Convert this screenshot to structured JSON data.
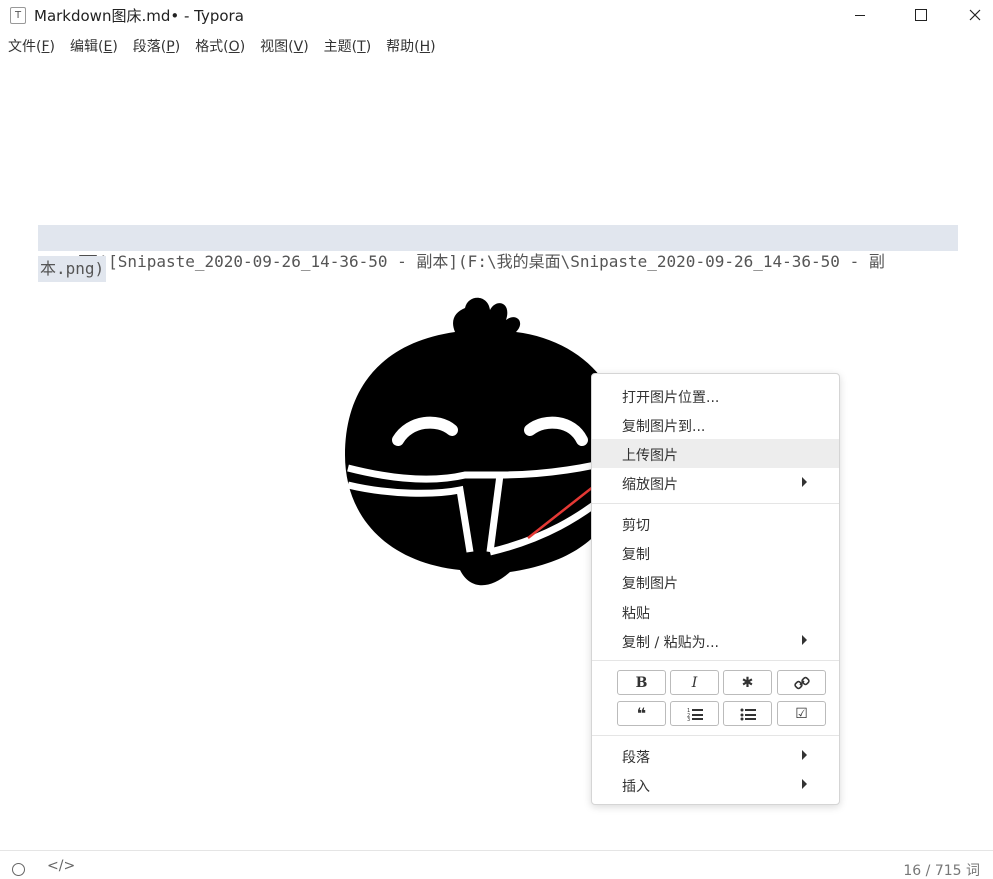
{
  "window": {
    "title": "Markdown图床.md• - Typora",
    "app_icon_letter": "T"
  },
  "menubar": {
    "items": [
      {
        "label": "文件(",
        "key": "F",
        "end": ")"
      },
      {
        "label": "编辑(",
        "key": "E",
        "end": ")"
      },
      {
        "label": "段落(",
        "key": "P",
        "end": ")"
      },
      {
        "label": "格式(",
        "key": "O",
        "end": ")"
      },
      {
        "label": "视图(",
        "key": "V",
        "end": ")"
      },
      {
        "label": "主题(",
        "key": "T",
        "end": ")"
      },
      {
        "label": "帮助(",
        "key": "H",
        "end": ")"
      }
    ]
  },
  "editor": {
    "markdown_line1": "![Snipaste_2020-09-26_14-36-50 - 副本](F:\\我的桌面\\Snipaste_2020-09-26_14-36-50 - 副",
    "markdown_line2": "本.png)"
  },
  "context_menu": {
    "items": [
      {
        "label": "打开图片位置...",
        "submenu": false
      },
      {
        "label": "复制图片到...",
        "submenu": false
      },
      {
        "label": "上传图片",
        "submenu": false,
        "highlighted": true
      },
      {
        "label": "缩放图片",
        "submenu": true
      },
      {
        "label": "剪切",
        "submenu": false
      },
      {
        "label": "复制",
        "submenu": false
      },
      {
        "label": "复制图片",
        "submenu": false
      },
      {
        "label": "粘贴",
        "submenu": false
      },
      {
        "label": "复制 / 粘贴为...",
        "submenu": true
      },
      {
        "label": "段落",
        "submenu": true
      },
      {
        "label": "插入",
        "submenu": true
      }
    ],
    "format_buttons": [
      {
        "icon": "bold-icon",
        "glyph": "B"
      },
      {
        "icon": "italic-icon",
        "glyph": "I"
      },
      {
        "icon": "code-icon",
        "glyph": "✱"
      },
      {
        "icon": "link-icon",
        "glyph": "🔗"
      },
      {
        "icon": "quote-icon",
        "glyph": "❝"
      },
      {
        "icon": "ordered-list-icon",
        "glyph": "☰"
      },
      {
        "icon": "unordered-list-icon",
        "glyph": "☰"
      },
      {
        "icon": "task-list-icon",
        "glyph": "☑"
      }
    ]
  },
  "statusbar": {
    "word_count": "16 / 715 词",
    "code_toggle": "</>"
  },
  "colors": {
    "selection": "#e1e6ee",
    "menu_highlight": "#ededed",
    "annotation_arrow": "#e53935"
  }
}
